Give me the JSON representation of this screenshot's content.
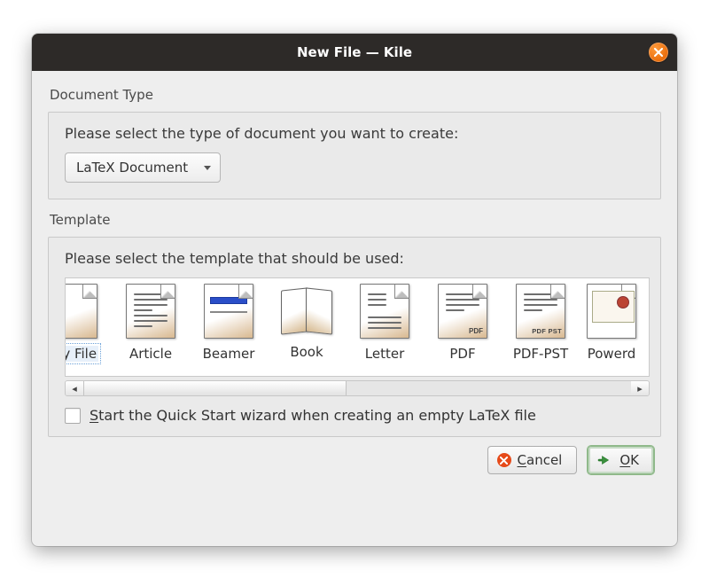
{
  "title": "New File — Kile",
  "document_type": {
    "label": "Document Type",
    "prompt": "Please select the type of document you want to create:",
    "value": "LaTeX Document"
  },
  "template": {
    "label": "Template",
    "prompt": "Please select the template that should be used:",
    "items": [
      {
        "label": "Empty File",
        "display_clip": "pty File",
        "kind": "blank",
        "selected": true
      },
      {
        "label": "Article",
        "kind": "text"
      },
      {
        "label": "Beamer",
        "kind": "beamer"
      },
      {
        "label": "Book",
        "kind": "book"
      },
      {
        "label": "Letter",
        "kind": "text"
      },
      {
        "label": "PDF",
        "kind": "pdf"
      },
      {
        "label": "PDF-PST",
        "kind": "pdfpst"
      },
      {
        "label": "Powerdot",
        "display_clip": "Powerd",
        "kind": "powerdot"
      }
    ]
  },
  "checkbox": {
    "before": "S",
    "after": "tart the Quick Start wizard when creating an empty LaTeX file",
    "checked": false
  },
  "buttons": {
    "cancel": {
      "before": "C",
      "after": "ancel"
    },
    "ok": {
      "before": "O",
      "after": "K"
    }
  }
}
